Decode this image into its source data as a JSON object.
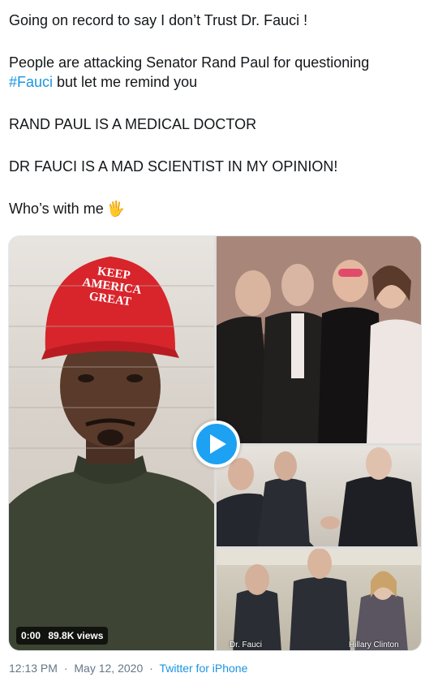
{
  "tweet": {
    "line1": "Going on record to say I don’t Trust Dr. Fauci !",
    "line2_before": "People are attacking Senator Rand Paul for questioning",
    "hashtag": "#Fauci",
    "line3_after": " but let me remind you",
    "line4": "RAND PAUL IS A MEDICAL DOCTOR",
    "line5": "DR FAUCI IS A MAD SCIENTIST IN MY OPINION!",
    "line6": "Who’s with me",
    "emoji": "🖐"
  },
  "media": {
    "hat_text_1": "KEEP",
    "hat_text_2": "AMERICA",
    "hat_text_3": "GREAT",
    "caption_fauci": "Dr. Fauci",
    "caption_clinton": "Hillary Clinton",
    "duration": "0:00",
    "views": "89.8K views"
  },
  "meta": {
    "time": "12:13 PM",
    "date": "May 12, 2020",
    "separator": "·",
    "source": "Twitter for iPhone"
  },
  "colors": {
    "link": "#1b95e0",
    "play": "#1da1f2",
    "meta": "#657786"
  }
}
